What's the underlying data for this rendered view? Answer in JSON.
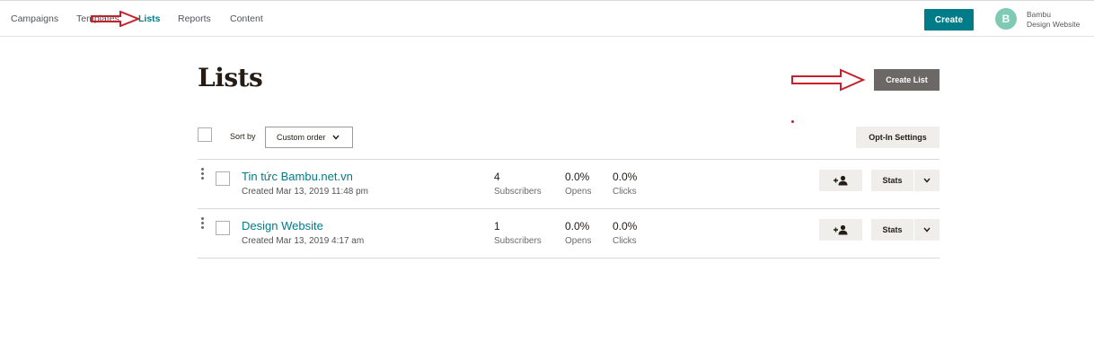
{
  "nav": {
    "items": [
      {
        "label": "Campaigns",
        "active": false
      },
      {
        "label": "Templates",
        "active": false
      },
      {
        "label": "Lists",
        "active": true
      },
      {
        "label": "Reports",
        "active": false
      },
      {
        "label": "Content",
        "active": false
      }
    ],
    "create_label": "Create",
    "account": {
      "initial": "B",
      "name": "Bambu",
      "sub": "Design Website"
    }
  },
  "page": {
    "title": "Lists",
    "create_list_label": "Create List",
    "sort_label": "Sort by",
    "sort_value": "Custom order",
    "optin_label": "Opt-In Settings"
  },
  "lists": [
    {
      "name": "Tin tức Bambu.net.vn",
      "created": "Created Mar 13, 2019 11:48 pm",
      "subscribers": "4",
      "subscribers_label": "Subscribers",
      "opens": "0.0%",
      "opens_label": "Opens",
      "clicks": "0.0%",
      "clicks_label": "Clicks",
      "stats_label": "Stats"
    },
    {
      "name": "Design Website",
      "created": "Created Mar 13, 2019 4:17 am",
      "subscribers": "1",
      "subscribers_label": "Subscribers",
      "opens": "0.0%",
      "opens_label": "Opens",
      "clicks": "0.0%",
      "clicks_label": "Clicks",
      "stats_label": "Stats"
    }
  ],
  "colors": {
    "accent": "#007c89",
    "annotation": "#c8202a"
  }
}
